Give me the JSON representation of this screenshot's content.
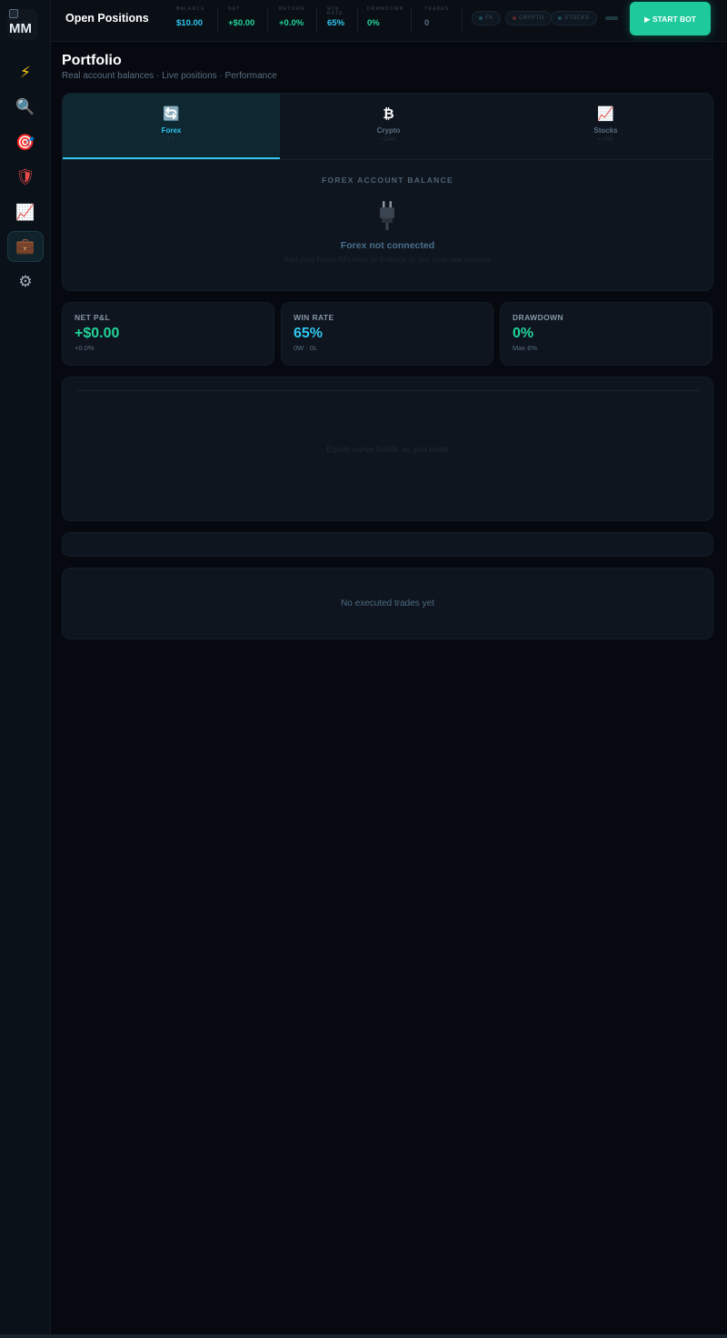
{
  "sidebar": {
    "logo_text": "MM",
    "items": [
      {
        "icon": "bolt-icon",
        "glyph": "⚡"
      },
      {
        "icon": "search-icon",
        "glyph": "🔍"
      },
      {
        "icon": "target-icon",
        "glyph": "🎯"
      },
      {
        "icon": "shield-icon",
        "glyph": "🛡"
      },
      {
        "icon": "chart-icon",
        "glyph": "📈"
      },
      {
        "icon": "briefcase-icon",
        "glyph": "💼",
        "active": true
      },
      {
        "icon": "gear-icon",
        "glyph": "⚙"
      }
    ]
  },
  "topbar": {
    "title": "Open Positions",
    "stats": [
      {
        "label": "BALANCE",
        "value": "$10.00",
        "color": "#2ec8f0"
      },
      {
        "label": "NET",
        "value": "+$0.00",
        "color": "#22d39a"
      },
      {
        "label": "RETURN",
        "value": "+0.0%",
        "color": "#22d39a"
      },
      {
        "label": "WIN RATE",
        "value": "65%",
        "color": "#2ec8f0"
      },
      {
        "label": "DRAWDOWN",
        "value": "0%",
        "color": "#22d39a"
      },
      {
        "label": "TRADES",
        "value": "0",
        "color": "#5a6d80"
      }
    ],
    "pills": [
      {
        "label": "FX",
        "dot": "#1f4d5a"
      },
      {
        "label": "CRYPTO",
        "dot": "#5a2a2a"
      },
      {
        "label": "STOCKS",
        "dot": "#1f4d5a"
      }
    ],
    "start_button": "▶ START BOT"
  },
  "page": {
    "title": "Portfolio",
    "subtitle": "Real account balances · Live positions · Performance"
  },
  "tabs": [
    {
      "label": "Forex",
      "sub": "FX",
      "icon": "refresh-icon",
      "glyph": "🔄",
      "active": true
    },
    {
      "label": "Crypto",
      "sub": "• OAK",
      "icon": "bitcoin-icon",
      "glyph": "₿"
    },
    {
      "label": "Stocks",
      "sub": "• USA",
      "icon": "chart-icon",
      "glyph": "📈"
    }
  ],
  "balance": {
    "title": "FOREX ACCOUNT BALANCE",
    "status": "Forex not connected",
    "hint": "Add your Forex API keys in Settings to see your real balance"
  },
  "metrics": [
    {
      "label": "NET P&L",
      "value": "+$0.00",
      "sub": "+0.0%",
      "color": "#22d39a"
    },
    {
      "label": "WIN RATE",
      "value": "65%",
      "sub": "0W · 0L",
      "color": "#2ec8f0"
    },
    {
      "label": "DRAWDOWN",
      "value": "0%",
      "sub": "Max 6%",
      "color": "#22d39a"
    }
  ],
  "equity": {
    "empty": "Equity curve builds as you trade"
  },
  "trades": {
    "empty": "No executed trades yet"
  }
}
